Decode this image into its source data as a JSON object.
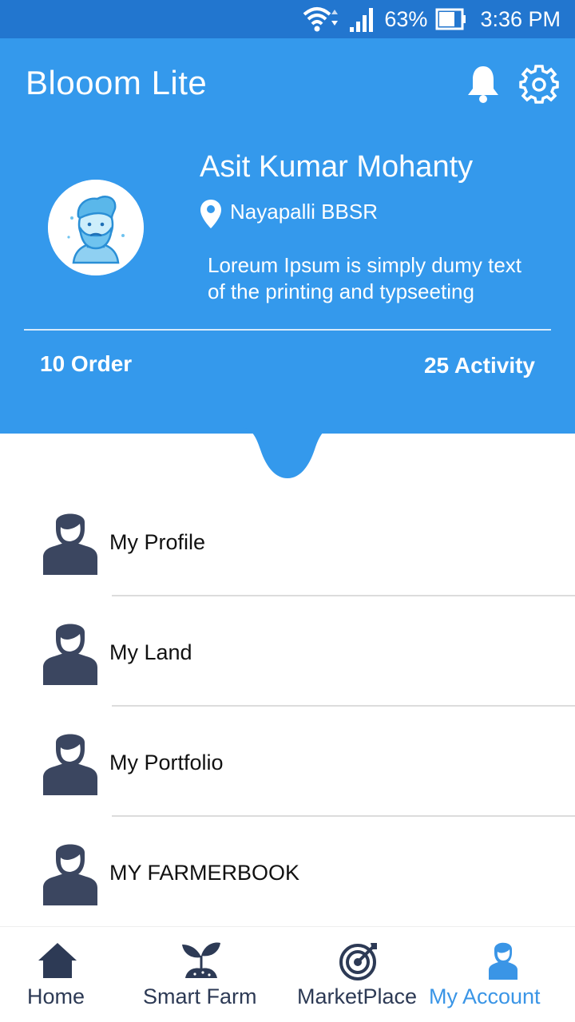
{
  "status_bar": {
    "battery": "63%",
    "time": "3:36 PM"
  },
  "header": {
    "app_title": "Blooom Lite",
    "user_name": "Asit Kumar Mohanty",
    "location": "Nayapalli BBSR",
    "bio_line1": "Loreum Ipsum is simply dumy text",
    "bio_line2": "of the printing and typseeting",
    "orders": "10 Order",
    "activity": "25 Activity"
  },
  "menu": {
    "items": [
      {
        "label": "My Profile",
        "icon": "person-icon"
      },
      {
        "label": "My Land",
        "icon": "person-icon"
      },
      {
        "label": "My Portfolio",
        "icon": "person-icon"
      },
      {
        "label": "MY FARMERBOOK",
        "icon": "person-icon"
      }
    ]
  },
  "bottom_nav": {
    "items": [
      {
        "label": "Home",
        "icon": "home-icon"
      },
      {
        "label": "Smart Farm",
        "icon": "plant-icon"
      },
      {
        "label": "MarketPlace",
        "icon": "target-icon"
      },
      {
        "label": "My Account",
        "icon": "account-icon",
        "active": true
      }
    ]
  },
  "colors": {
    "primary": "#3499ec",
    "status_bar": "#2276cf",
    "icon_dark": "#3b4660",
    "active": "#3a95e6"
  }
}
